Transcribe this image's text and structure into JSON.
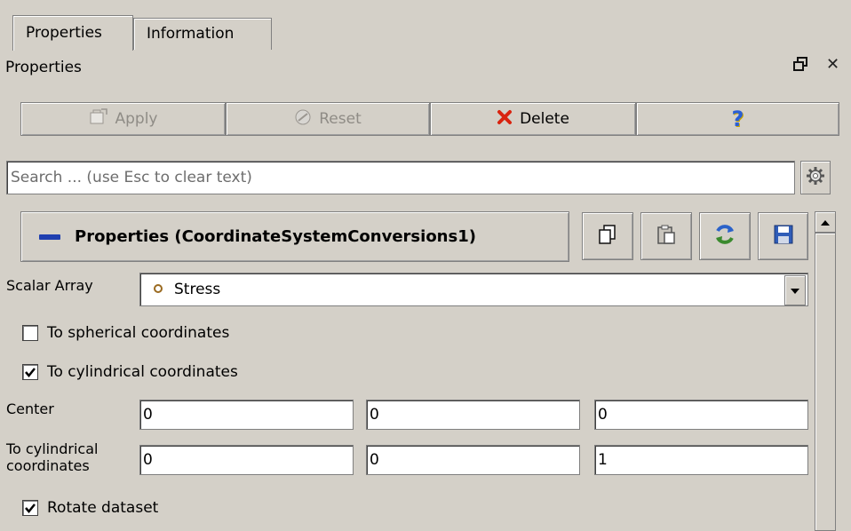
{
  "tabs": [
    {
      "label": "Properties"
    },
    {
      "label": "Information"
    }
  ],
  "panel": {
    "title": "Properties"
  },
  "toolbar": {
    "apply_label": "Apply",
    "reset_label": "Reset",
    "delete_label": "Delete"
  },
  "search": {
    "placeholder": "Search ... (use Esc to clear text)",
    "value": ""
  },
  "section": {
    "title": "Properties (CoordinateSystemConversions1)"
  },
  "scalar_array": {
    "label": "Scalar Array",
    "value": "Stress"
  },
  "options": {
    "spherical": {
      "label": "To spherical coordinates",
      "checked": false
    },
    "cylindrical": {
      "label": "To cylindrical coordinates",
      "checked": true
    },
    "rotate": {
      "label": "Rotate dataset",
      "checked": true
    }
  },
  "center": {
    "label": "Center",
    "values": [
      "0",
      "0",
      "0"
    ]
  },
  "axis": {
    "label_line1": "To cylindrical",
    "label_line2": "coordinates",
    "values": [
      "0",
      "0",
      "1"
    ]
  },
  "colors": {
    "background": "#d4d0c8",
    "delete_red": "#d9230f",
    "help_blue": "#2a5fd6",
    "accent_blue": "#1f3fb0"
  }
}
